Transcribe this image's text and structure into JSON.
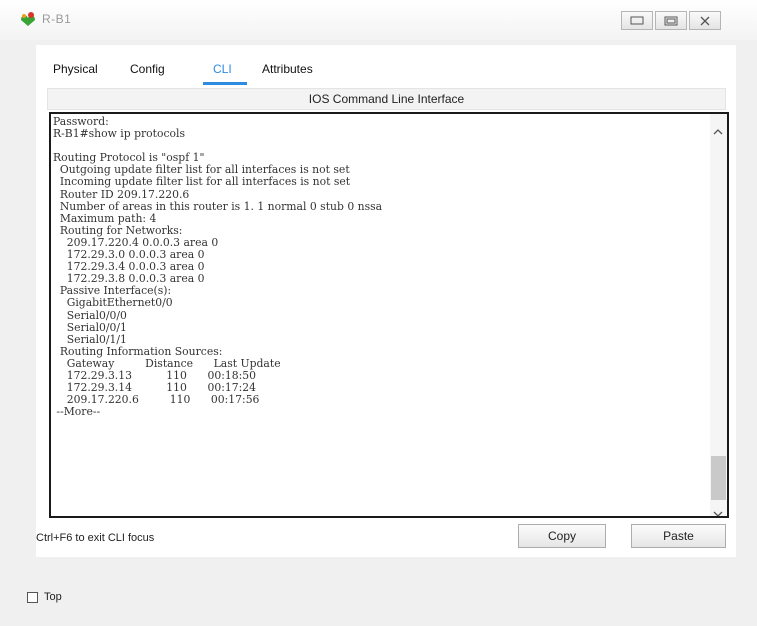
{
  "window": {
    "title": "R-B1",
    "controls": {
      "minimize": "minimize-icon",
      "maximize": "maximize-icon",
      "close": "close-icon"
    }
  },
  "tabs": [
    {
      "label": "Physical",
      "active": false
    },
    {
      "label": "Config",
      "active": false
    },
    {
      "label": "CLI",
      "active": true
    },
    {
      "label": "Attributes",
      "active": false
    }
  ],
  "cli": {
    "header": "IOS Command Line Interface",
    "output": "Password:\nR-B1#show ip protocols\n\nRouting Protocol is \"ospf 1\"\n  Outgoing update filter list for all interfaces is not set\n  Incoming update filter list for all interfaces is not set\n  Router ID 209.17.220.6\n  Number of areas in this router is 1. 1 normal 0 stub 0 nssa\n  Maximum path: 4\n  Routing for Networks:\n    209.17.220.4 0.0.0.3 area 0\n    172.29.3.0 0.0.0.3 area 0\n    172.29.3.4 0.0.0.3 area 0\n    172.29.3.8 0.0.0.3 area 0\n  Passive Interface(s):\n    GigabitEthernet0/0\n    Serial0/0/0\n    Serial0/0/1\n    Serial0/1/1\n  Routing Information Sources:\n    Gateway         Distance      Last Update\n    172.29.3.13          110      00:18:50\n    172.29.3.14          110      00:17:24\n    209.17.220.6         110      00:17:56\n --More--",
    "focus_hint": "Ctrl+F6 to exit CLI focus",
    "copy_label": "Copy",
    "paste_label": "Paste"
  },
  "footer": {
    "top_label": "Top",
    "top_checked": false
  },
  "colors": {
    "accent": "#2e8ce0"
  }
}
